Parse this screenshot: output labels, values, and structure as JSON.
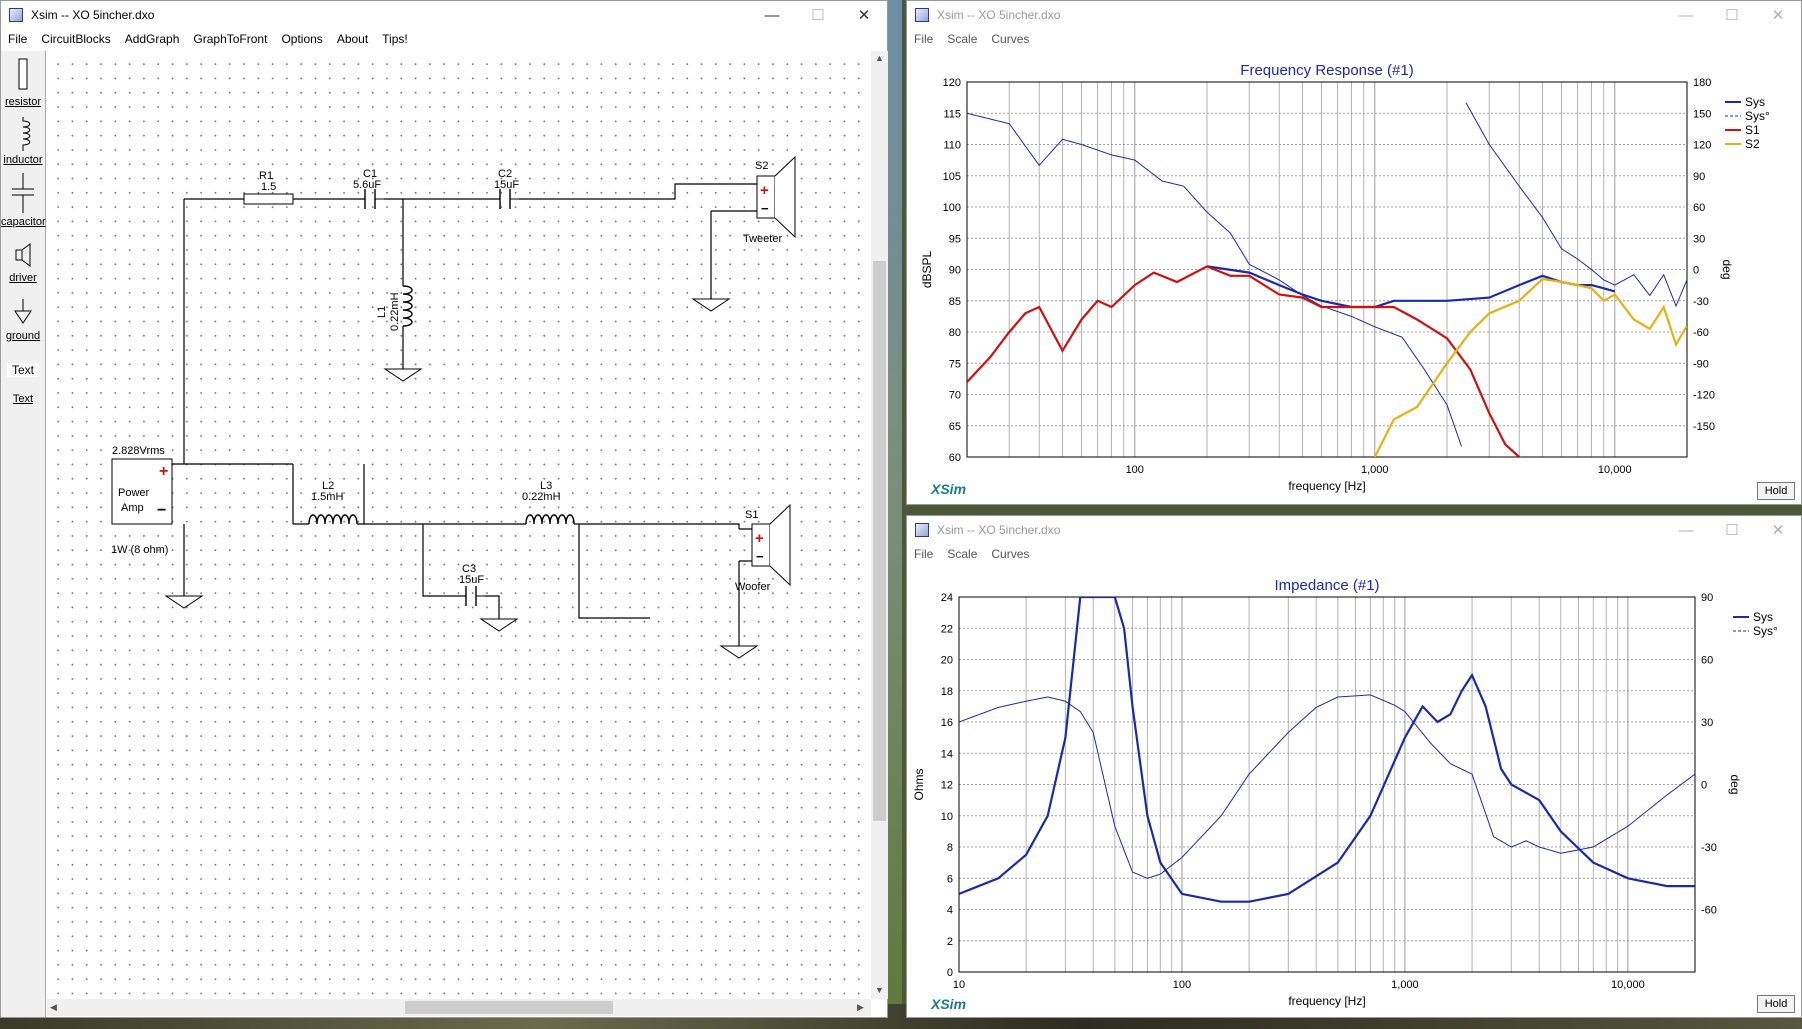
{
  "schematic_window": {
    "title": "Xsim -- XO 5incher.dxo",
    "menu": [
      "File",
      "CircuitBlocks",
      "AddGraph",
      "GraphToFront",
      "Options",
      "About",
      "Tips!"
    ],
    "palette": [
      {
        "label": "resistor",
        "icon": "resistor-icon"
      },
      {
        "label": "inductor",
        "icon": "inductor-icon"
      },
      {
        "label": "capacitor",
        "icon": "capacitor-icon"
      },
      {
        "label": "driver",
        "icon": "driver-icon"
      },
      {
        "label": "ground",
        "icon": "ground-icon"
      },
      {
        "label": "Text",
        "icon": "text-icon"
      },
      {
        "label": "Text",
        "icon": "text-link"
      }
    ],
    "components": {
      "R1": {
        "name": "R1",
        "value": "1.5"
      },
      "C1": {
        "name": "C1",
        "value": "5.6uF"
      },
      "C2": {
        "name": "C2",
        "value": "15uF"
      },
      "L1": {
        "name": "L1",
        "value": "0.22mH"
      },
      "S2": {
        "name": "S2",
        "label": "Tweeter"
      },
      "L2": {
        "name": "L2",
        "value": "1.5mH"
      },
      "L3": {
        "name": "L3",
        "value": "0.22mH"
      },
      "C3": {
        "name": "C3",
        "value": "15uF"
      },
      "S1": {
        "name": "S1",
        "label": "Woofer"
      },
      "amp": {
        "voltage": "2.828Vrms",
        "line1": "Power",
        "line2": "Amp",
        "power": "1W (8 ohm)"
      }
    }
  },
  "freq_window": {
    "title": "Xsim -- XO 5incher.dxo",
    "menu": [
      "File",
      "Scale",
      "Curves"
    ],
    "hold": "Hold",
    "brand": "XSim"
  },
  "imp_window": {
    "title": "Xsim -- XO 5incher.dxo",
    "menu": [
      "File",
      "Scale",
      "Curves"
    ],
    "hold": "Hold",
    "brand": "XSim"
  },
  "colors": {
    "sys": "#1a2aa8",
    "s1": "#d01010",
    "s2": "#e8b010",
    "title_blue": "#1a2aa8"
  },
  "chart_data": [
    {
      "type": "line",
      "title": "Frequency Response (#1)",
      "xlabel": "frequency [Hz]",
      "ylabel": "dBSPL",
      "y2label": "deg",
      "xscale": "log",
      "xlim": [
        20,
        20000
      ],
      "ylim": [
        60,
        120
      ],
      "y2lim": [
        -180,
        180
      ],
      "xticks": [
        "100",
        "1,000",
        "10,000"
      ],
      "yticks": [
        "120",
        "115",
        "110",
        "105",
        "100",
        "95",
        "90",
        "85",
        "80",
        "75",
        "70",
        "65",
        "60"
      ],
      "y2ticks": [
        "180",
        "150",
        "120",
        "90",
        "60",
        "30",
        "0",
        "-30",
        "-60",
        "-90",
        "-120",
        "-150"
      ],
      "grid": true,
      "legend_position": "top-right",
      "series": [
        {
          "name": "Sys",
          "color": "#1a2aa8",
          "style": "solid",
          "axis": "left",
          "x": [
            200,
            300,
            400,
            500,
            600,
            800,
            1000,
            1200,
            1500,
            2000,
            3000,
            4000,
            5000,
            6000,
            7000,
            8000,
            9000,
            10000
          ],
          "y": [
            90.5,
            89.5,
            87.5,
            86,
            85,
            84,
            84,
            85,
            85,
            85,
            85.5,
            87.5,
            89,
            88,
            87.5,
            87.5,
            87,
            86.5
          ]
        },
        {
          "name": "Sys°",
          "color": "#1a2aa8",
          "style": "dashed",
          "axis": "right",
          "x": [
            20,
            30,
            40,
            50,
            60,
            80,
            100,
            130,
            160,
            200,
            250,
            300,
            400,
            500,
            600,
            800,
            1000,
            1300,
            1600,
            2000,
            2300,
            2400,
            3000,
            4000,
            5000,
            6000,
            7000,
            8000,
            9000,
            10000,
            12000,
            14000,
            16000,
            18000,
            20000
          ],
          "y": [
            150,
            140,
            100,
            125,
            120,
            110,
            105,
            85,
            80,
            55,
            35,
            5,
            -10,
            -25,
            -35,
            -45,
            -55,
            -65,
            -95,
            -130,
            -170,
            160,
            120,
            80,
            50,
            20,
            10,
            0,
            -10,
            -15,
            -5,
            -25,
            -5,
            -35,
            -10
          ]
        },
        {
          "name": "S1",
          "color": "#d01010",
          "style": "solid",
          "axis": "left",
          "x": [
            20,
            25,
            30,
            35,
            40,
            50,
            60,
            70,
            80,
            100,
            120,
            150,
            200,
            250,
            300,
            400,
            500,
            600,
            800,
            1000,
            1200,
            1500,
            2000,
            2500,
            3000,
            3500,
            4000,
            5000,
            6000
          ],
          "y": [
            72,
            76,
            80,
            83,
            84,
            77,
            82,
            85,
            84,
            87.5,
            89.5,
            88,
            90.5,
            89,
            89,
            86,
            85.5,
            84,
            84,
            84,
            84,
            82,
            79,
            74,
            67,
            62,
            60,
            58,
            59
          ]
        },
        {
          "name": "S2",
          "color": "#e8b010",
          "style": "solid",
          "axis": "left",
          "x": [
            1000,
            1200,
            1500,
            2000,
            2500,
            3000,
            4000,
            5000,
            6000,
            7000,
            8000,
            9000,
            10000,
            12000,
            14000,
            16000,
            18000,
            20000
          ],
          "y": [
            60,
            66,
            68,
            75,
            80,
            83,
            85,
            88.5,
            88,
            87.5,
            87,
            85,
            86,
            82,
            80.5,
            84,
            78,
            81
          ]
        }
      ]
    },
    {
      "type": "line",
      "title": "Impedance (#1)",
      "xlabel": "frequency [Hz]",
      "ylabel": "Ohms",
      "y2label": "deg",
      "xscale": "log",
      "xlim": [
        10,
        20000
      ],
      "ylim": [
        0,
        24
      ],
      "y2lim": [
        -90,
        90
      ],
      "xticks": [
        "10",
        "100",
        "1,000",
        "10,000"
      ],
      "yticks": [
        "24",
        "22",
        "20",
        "18",
        "16",
        "14",
        "12",
        "10",
        "8",
        "6",
        "4",
        "2",
        "0"
      ],
      "y2ticks": [
        "90",
        "60",
        "30",
        "0",
        "-30",
        "-60"
      ],
      "grid": true,
      "legend_position": "top-right",
      "series": [
        {
          "name": "Sys",
          "color": "#1a2aa8",
          "style": "solid",
          "axis": "left",
          "x": [
            10,
            15,
            20,
            25,
            30,
            35,
            40,
            45,
            50,
            55,
            60,
            70,
            80,
            100,
            150,
            200,
            300,
            500,
            700,
            1000,
            1200,
            1400,
            1600,
            1800,
            2000,
            2300,
            2700,
            3000,
            4000,
            5000,
            7000,
            10000,
            15000,
            20000
          ],
          "y": [
            5,
            6,
            7.5,
            10,
            15,
            24,
            24,
            24,
            24,
            22,
            17,
            10,
            7,
            5,
            4.5,
            4.5,
            5,
            7,
            10,
            15,
            17,
            16,
            16.5,
            18,
            19,
            17,
            13,
            12,
            11,
            9,
            7,
            6,
            5.5,
            5.5
          ]
        },
        {
          "name": "Sys°",
          "color": "#1a2aa8",
          "style": "dashed",
          "axis": "right",
          "x": [
            10,
            15,
            20,
            25,
            30,
            35,
            40,
            50,
            60,
            70,
            80,
            100,
            150,
            200,
            300,
            400,
            500,
            700,
            900,
            1000,
            1300,
            1600,
            2000,
            2500,
            3000,
            3500,
            4000,
            5000,
            7000,
            10000,
            15000,
            20000
          ],
          "y": [
            30,
            37,
            40,
            42,
            40,
            35,
            25,
            -20,
            -42,
            -45,
            -43,
            -35,
            -15,
            5,
            25,
            37,
            42,
            43,
            38,
            35,
            20,
            10,
            5,
            -25,
            -30,
            -27,
            -30,
            -33,
            -30,
            -20,
            -5,
            5
          ]
        }
      ]
    }
  ]
}
